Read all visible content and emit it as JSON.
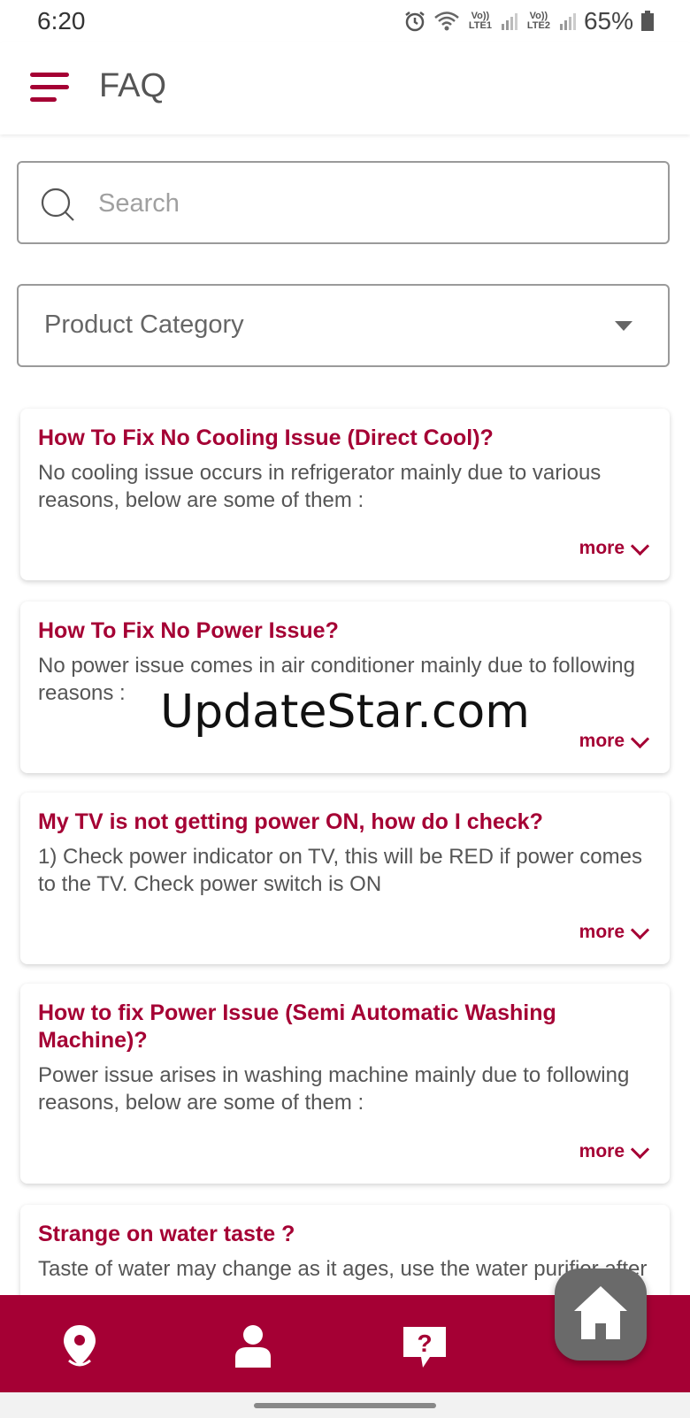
{
  "status_bar": {
    "time": "6:20",
    "lte1": "Vo)) LTE1",
    "lte2": "Vo)) LTE2",
    "battery": "65%"
  },
  "app_bar": {
    "title": "FAQ"
  },
  "search": {
    "placeholder": "Search"
  },
  "category": {
    "label": "Product Category"
  },
  "faq_items": [
    {
      "title": "How To Fix No Cooling Issue (Direct Cool)?",
      "body": "No cooling issue occurs in refrigerator mainly due to various reasons, below are some of them :",
      "more_label": "more"
    },
    {
      "title": "How To Fix No Power Issue?",
      "body": "No power issue comes in air conditioner mainly due to following reasons :",
      "more_label": "more"
    },
    {
      "title": "My TV is not getting power ON, how do I check?",
      "body": "1) Check power indicator on TV, this will be RED if power comes to the TV. Check power switch is ON",
      "more_label": "more"
    },
    {
      "title": "How to fix Power Issue (Semi Automatic Washing Machine)?",
      "body": "Power issue arises in washing machine mainly due to following reasons, below are some of them :",
      "more_label": "more"
    },
    {
      "title": "Strange on water taste ?",
      "body": "Taste of water may change as it ages, use the water purifier after"
    }
  ],
  "watermark": "UpdateStar.com",
  "bottom_nav": {
    "icons": [
      "location-icon",
      "person-icon",
      "help-icon"
    ],
    "home_icon": "home-icon"
  },
  "colors": {
    "brand": "#a50034",
    "fab": "#6a6a6a"
  }
}
